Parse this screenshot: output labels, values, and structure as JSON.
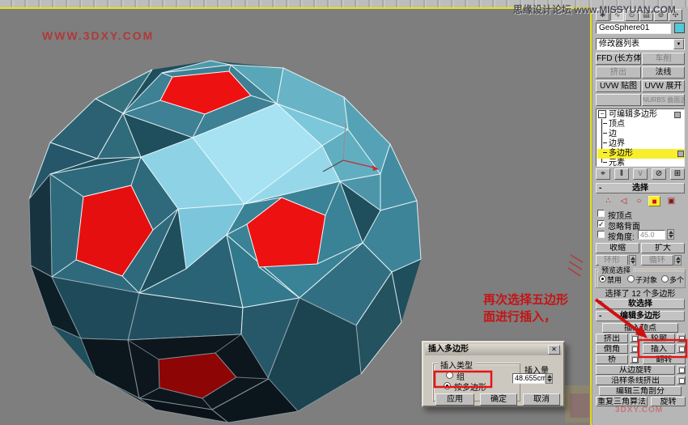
{
  "watermarks": {
    "top_left": "WWW.3DXY.COM",
    "top_right_cn": "思缘设计论坛",
    "top_right_en": "www.MISSYUAN.COM",
    "bottom_right": "3DXY.COM"
  },
  "annotation": {
    "line1": "再次选择五边形",
    "line2": "面进行插入，"
  },
  "command_panel": {
    "object_name": "GeoSphere01",
    "modifier_list_label": "修改器列表",
    "modifier_buttons": {
      "r1c1": "FFD (长方体)",
      "r1c2": "车削",
      "r2c1": "挤出",
      "r2c2": "法线",
      "r3c1": "UVW 贴图",
      "r3c2": "UVW 展开",
      "r4c1": "",
      "r4c2": "NURBS 曲面选择"
    },
    "stack": {
      "root": "可编辑多边形",
      "items": [
        "顶点",
        "边",
        "边界",
        "多边形",
        "元素"
      ],
      "selected_item": "多边形"
    },
    "selection": {
      "title": "选择",
      "by_vertex": "按顶点",
      "ignore_backfacing": "忽略背面",
      "by_angle": "按角度:",
      "angle_value": "45.0",
      "shrink": "收缩",
      "grow": "扩大",
      "ring": "环形",
      "loop": "循环",
      "preview_title": "预览选择",
      "preview_disable": "禁用",
      "preview_subobj": "子对象",
      "preview_multi": "多个",
      "status": "选择了 12 个多边形"
    },
    "soft_selection_title": "软选择",
    "edit_polygons": {
      "title": "编辑多边形",
      "insert_vertex": "插入顶点",
      "extrude": "挤出",
      "outline": "轮廓",
      "bevel": "倒角",
      "inset": "插入",
      "bridge": "桥",
      "flip": "翻转",
      "hinge_from_edge": "从边旋转",
      "extrude_along_spline": "沿样条线挤出",
      "edit_triangulation": "编辑三角剖分",
      "retriangulate": "重复三角算法",
      "turn": "旋转"
    }
  },
  "dialog": {
    "title": "插入多边形",
    "close": "✕",
    "group_title": "插入类型",
    "radio_group": "组",
    "radio_by_polygon": "按多边形",
    "amount_label": "插入量",
    "amount_value": "48.655cm",
    "apply": "应用",
    "ok": "确定",
    "cancel": "取消"
  },
  "icons": {
    "tab_create": "✱",
    "tab_modify": "∿",
    "tab_hierarchy": "⊙",
    "tab_motion": "▤",
    "tab_display": "⊚",
    "tab_utilities": "✣",
    "dropdown_arrow": "▼",
    "expand_minus": "−",
    "pin_stack": "⌖",
    "show_end_result": "‖",
    "make_unique": "∨",
    "remove_modifier": "⊘",
    "configure_sets": "⊞",
    "subobj_vertex": "∴",
    "subobj_edge": "◁",
    "subobj_border": "○",
    "subobj_polygon": "■",
    "subobj_element": "▣",
    "check": "✓"
  },
  "colors": {
    "viewport_bg": "#7e7e7e",
    "panel_bg": "#b6b6b6",
    "active_border_yellow": "#e6e21a",
    "stack_highlight_yellow": "#f7ee2e",
    "selection_red": "#ee1111",
    "selection_red_shaded": "#8d0505",
    "annotation_red": "#c51414",
    "object_color_swatch": "#52c8da",
    "face_light_cyan": "#a6e2f2",
    "face_teal": "#3e8094",
    "face_dark": "#0d161c"
  }
}
